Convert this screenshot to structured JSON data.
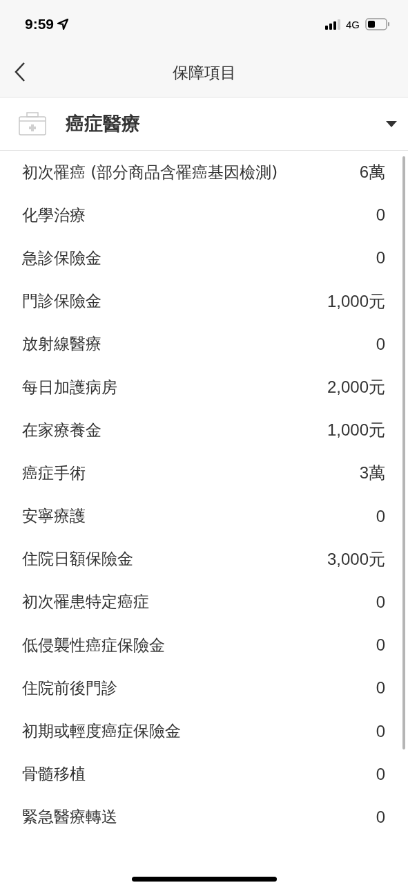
{
  "status_bar": {
    "time": "9:59",
    "network": "4G"
  },
  "nav": {
    "title": "保障項目"
  },
  "category": {
    "label": "癌症醫療"
  },
  "items": [
    {
      "name": "初次罹癌 (部分商品含罹癌基因檢測)",
      "amount": "6萬"
    },
    {
      "name": "化學治療",
      "amount": "0"
    },
    {
      "name": "急診保險金",
      "amount": "0"
    },
    {
      "name": "門診保險金",
      "amount": "1,000元"
    },
    {
      "name": "放射線醫療",
      "amount": "0"
    },
    {
      "name": "每日加護病房",
      "amount": "2,000元"
    },
    {
      "name": "在家療養金",
      "amount": "1,000元"
    },
    {
      "name": "癌症手術",
      "amount": "3萬"
    },
    {
      "name": "安寧療護",
      "amount": "0"
    },
    {
      "name": "住院日額保險金",
      "amount": "3,000元"
    },
    {
      "name": "初次罹患特定癌症",
      "amount": "0"
    },
    {
      "name": "低侵襲性癌症保險金",
      "amount": "0"
    },
    {
      "name": "住院前後門診",
      "amount": "0"
    },
    {
      "name": "初期或輕度癌症保險金",
      "amount": "0"
    },
    {
      "name": "骨髓移植",
      "amount": "0"
    },
    {
      "name": "緊急醫療轉送",
      "amount": "0"
    }
  ]
}
